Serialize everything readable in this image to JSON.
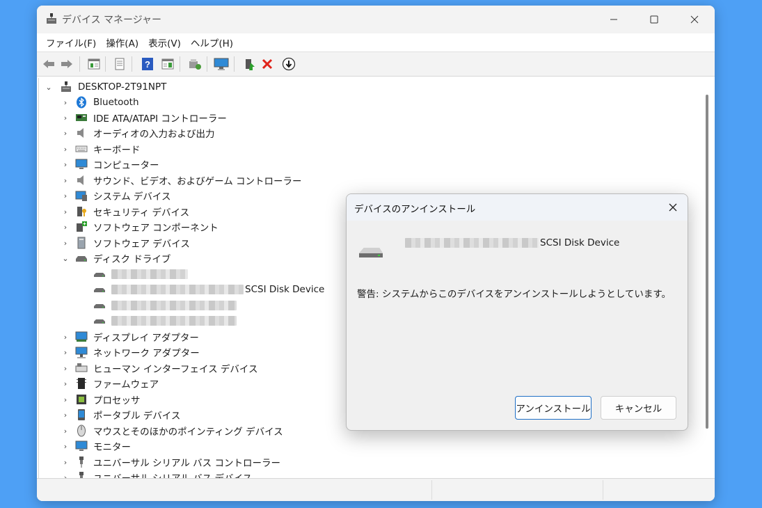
{
  "window": {
    "title": "デバイス マネージャー"
  },
  "menu": [
    "ファイル(F)",
    "操作(A)",
    "表示(V)",
    "ヘルプ(H)"
  ],
  "toolbar_icons": [
    "back-arrow-icon",
    "forward-arrow-icon",
    "properties-view-icon",
    "driver-doc-icon",
    "help-icon",
    "action-pane-icon",
    "scan-hardware-icon",
    "monitor-icon",
    "update-driver-icon",
    "uninstall-x-icon",
    "disable-device-icon"
  ],
  "tree": {
    "root": "DESKTOP-2T91NPT",
    "categories": [
      {
        "label": "Bluetooth",
        "icon": "bluetooth-icon"
      },
      {
        "label": "IDE ATA/ATAPI コントローラー",
        "icon": "ide-controller-icon"
      },
      {
        "label": "オーディオの入力および出力",
        "icon": "speaker-icon"
      },
      {
        "label": "キーボード",
        "icon": "keyboard-icon"
      },
      {
        "label": "コンピューター",
        "icon": "computer-icon"
      },
      {
        "label": "サウンド、ビデオ、およびゲーム コントローラー",
        "icon": "speaker-icon"
      },
      {
        "label": "システム デバイス",
        "icon": "system-device-icon"
      },
      {
        "label": "セキュリティ デバイス",
        "icon": "security-key-icon"
      },
      {
        "label": "ソフトウェア コンポーネント",
        "icon": "software-component-icon"
      },
      {
        "label": "ソフトウェア デバイス",
        "icon": "software-device-icon"
      },
      {
        "label": "ディスク ドライブ",
        "icon": "disk-drive-icon",
        "expanded": true
      },
      {
        "label": "ディスプレイ アダプター",
        "icon": "display-adapter-icon"
      },
      {
        "label": "ネットワーク アダプター",
        "icon": "network-adapter-icon"
      },
      {
        "label": "ヒューマン インターフェイス デバイス",
        "icon": "hid-icon"
      },
      {
        "label": "ファームウェア",
        "icon": "firmware-icon"
      },
      {
        "label": "プロセッサ",
        "icon": "processor-icon"
      },
      {
        "label": "ポータブル デバイス",
        "icon": "portable-device-icon"
      },
      {
        "label": "マウスとそのほかのポインティング デバイス",
        "icon": "mouse-icon"
      },
      {
        "label": "モニター",
        "icon": "monitor-icon"
      },
      {
        "label": "ユニバーサル シリアル バス コントローラー",
        "icon": "usb-icon"
      },
      {
        "label": "ユニバーサル シリアル バス デバイス",
        "icon": "usb-icon"
      }
    ],
    "disk_children": [
      {
        "suffix": ""
      },
      {
        "suffix": "SCSI Disk Device"
      },
      {
        "suffix": ""
      },
      {
        "suffix": ""
      }
    ]
  },
  "dialog": {
    "title": "デバイスのアンインストール",
    "device_suffix": "SCSI Disk Device",
    "warning": "警告: システムからこのデバイスをアンインストールしようとしています。",
    "uninstall_label": "アンインストール",
    "cancel_label": "キャンセル"
  },
  "colors": {
    "desktop": "#4ea0f5",
    "accent": "#1e6fc6",
    "uninstall_red": "#e0241b"
  }
}
